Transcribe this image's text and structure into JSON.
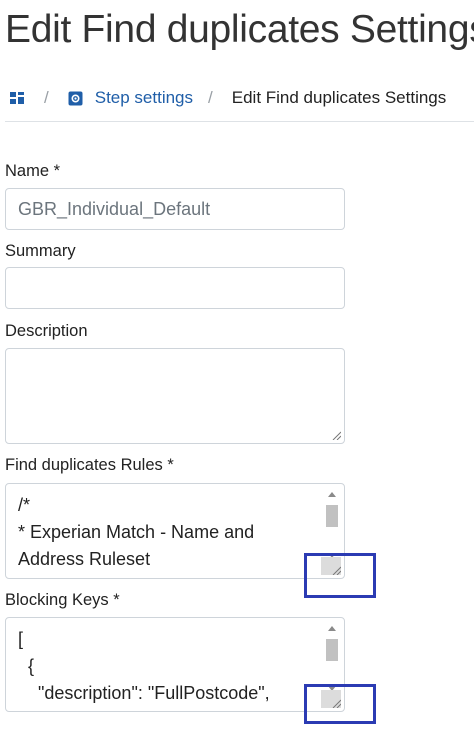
{
  "page": {
    "title": "Edit Find duplicates Settings"
  },
  "breadcrumb": {
    "home_icon": "dashboard-grid-icon",
    "separator": "/",
    "step_icon": "gear-square-icon",
    "step_label": "Step settings",
    "current": "Edit Find duplicates Settings"
  },
  "form": {
    "name": {
      "label": "Name *",
      "value": "GBR_Individual_Default"
    },
    "summary": {
      "label": "Summary",
      "value": ""
    },
    "description": {
      "label": "Description",
      "value": ""
    },
    "rules": {
      "label": "Find duplicates Rules *",
      "value": "/*\n* Experian Match - Name and\nAddress Ruleset"
    },
    "blocking_keys": {
      "label": "Blocking Keys *",
      "value": "[\n  {\n    \"description\": \"FullPostcode\","
    }
  },
  "colors": {
    "link": "#1f5ea8",
    "highlight_box": "#2b3bb3"
  }
}
